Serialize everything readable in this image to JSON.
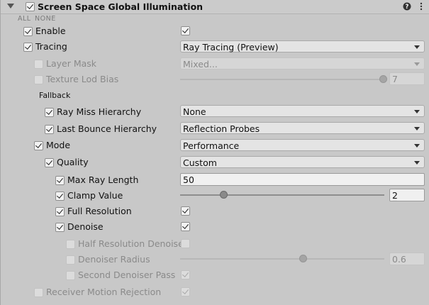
{
  "header": {
    "title": "Screen Space Global Illumination",
    "enabled": true,
    "help_icon": "help-icon",
    "menu_icon": "menu-kebab-icon"
  },
  "quick_select": {
    "all": "ALL",
    "none": "NONE"
  },
  "rows": {
    "enable": {
      "label": "Enable",
      "override": true,
      "value": true
    },
    "tracing": {
      "label": "Tracing",
      "override": true,
      "value": "Ray Tracing (Preview)"
    },
    "layer_mask": {
      "label": "Layer Mask",
      "override": false,
      "value": "Mixed..."
    },
    "texture_lod_bias": {
      "label": "Texture Lod Bias",
      "override": false,
      "value": "7",
      "slider_fraction": 1.0
    },
    "fallback": {
      "label": "Fallback"
    },
    "ray_miss_hierarchy": {
      "label": "Ray Miss Hierarchy",
      "override": true,
      "value": "None"
    },
    "last_bounce_hierarchy": {
      "label": "Last Bounce Hierarchy",
      "override": true,
      "value": "Reflection Probes"
    },
    "mode": {
      "label": "Mode",
      "override": true,
      "value": "Performance"
    },
    "quality": {
      "label": "Quality",
      "override": true,
      "value": "Custom"
    },
    "max_ray_length": {
      "label": "Max Ray Length",
      "override": true,
      "value": "50"
    },
    "clamp_value": {
      "label": "Clamp Value",
      "override": true,
      "value": "2",
      "slider_fraction": 0.2
    },
    "full_resolution": {
      "label": "Full Resolution",
      "override": true,
      "value": true
    },
    "denoise": {
      "label": "Denoise",
      "override": true,
      "value": true
    },
    "half_resolution_denoiser": {
      "label": "Half Resolution Denoiser",
      "override": false,
      "value": false
    },
    "denoiser_radius": {
      "label": "Denoiser Radius",
      "override": false,
      "value": "0.6",
      "slider_fraction": 0.6
    },
    "second_denoiser_pass": {
      "label": "Second Denoiser Pass",
      "override": false,
      "value": true
    },
    "receiver_motion_rejection": {
      "label": "Receiver Motion Rejection",
      "override": false,
      "value": true
    }
  }
}
